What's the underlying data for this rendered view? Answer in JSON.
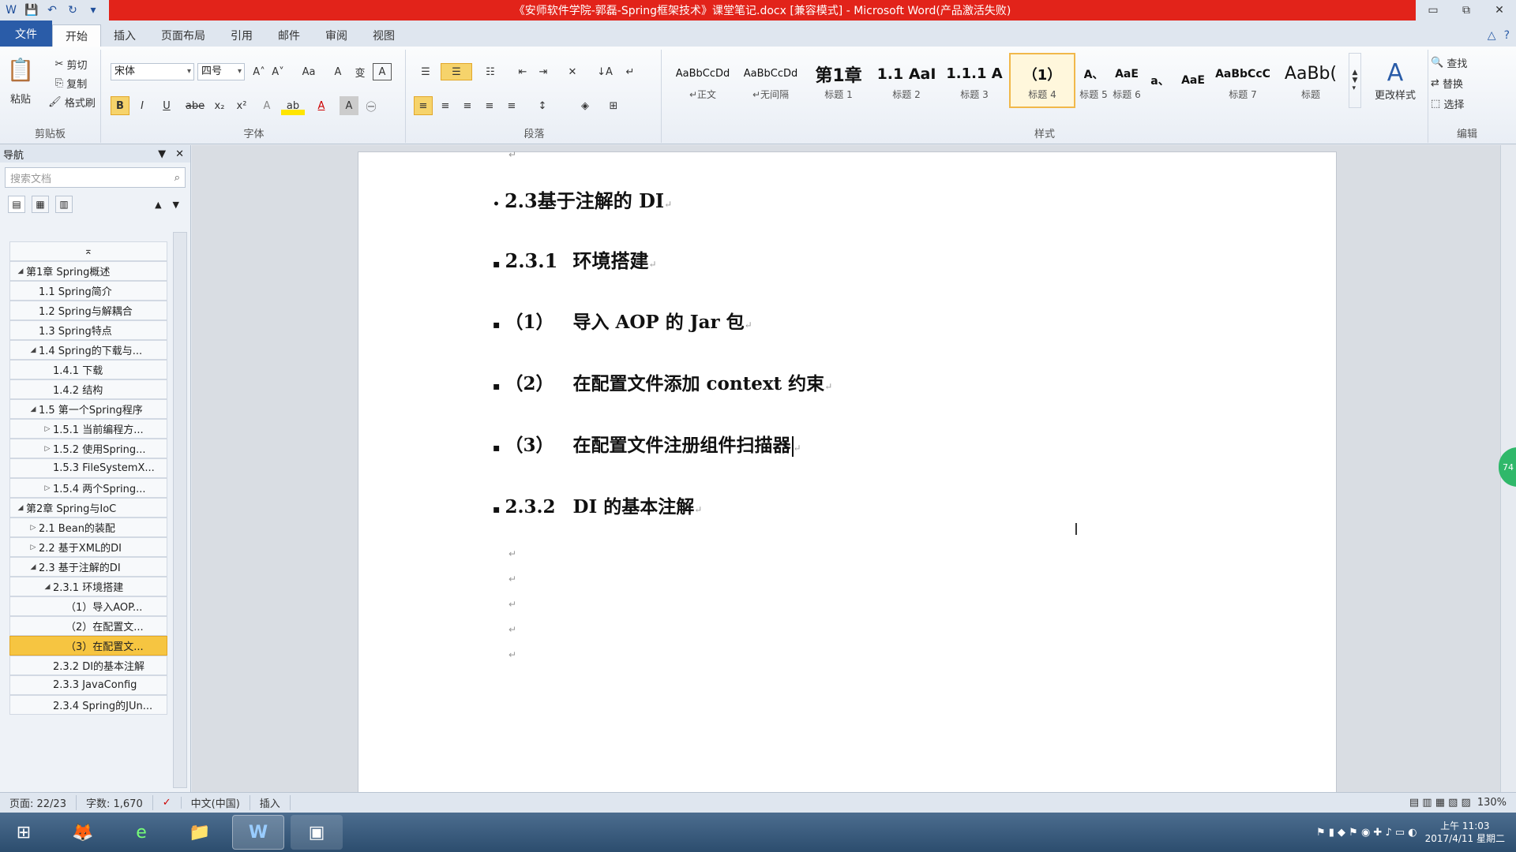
{
  "window": {
    "title": "《安师软件学院-郭磊-Spring框架技术》课堂笔记.docx [兼容模式] - Microsoft Word(产品激活失败)",
    "minimize_glyph": "▭",
    "restore_glyph": "⧉",
    "close_glyph": "✕"
  },
  "qat": {
    "word_glyph": "W",
    "save_glyph": "💾",
    "undo_glyph": "↶",
    "redo_glyph": "↻",
    "more_glyph": "▾"
  },
  "tabs": [
    {
      "label": "文件"
    },
    {
      "label": "开始"
    },
    {
      "label": "插入"
    },
    {
      "label": "页面布局"
    },
    {
      "label": "引用"
    },
    {
      "label": "邮件"
    },
    {
      "label": "审阅"
    },
    {
      "label": "视图"
    }
  ],
  "tab_right": {
    "collapse_glyph": "△",
    "help_glyph": "?"
  },
  "ribbon": {
    "clipboard": {
      "paste": "粘贴",
      "cut": "剪切",
      "copy": "复制",
      "format_painter": "格式刷",
      "label": "剪贴板"
    },
    "font": {
      "font_name": "宋体",
      "font_size": "四号",
      "grow": "A˄",
      "shrink": "A˅",
      "case": "Aa",
      "clear": "A",
      "pinyin": "变",
      "border_char": "A",
      "bold": "B",
      "italic": "I",
      "underline": "U",
      "strike": "abe",
      "sub": "x₂",
      "sup": "x²",
      "effects": "A",
      "highlight": "ab",
      "font_color": "A",
      "shade": "A",
      "enclose": "㊀",
      "label": "字体"
    },
    "paragraph": {
      "bullets": "☰",
      "numbering": "☰",
      "multilevel": "☷",
      "dec_indent": "⇤",
      "inc_indent": "⇥",
      "cjk_layout": "✕",
      "sort": "↓A",
      "show_marks": "↵",
      "align_left": "≡",
      "center": "≡",
      "align_right": "≡",
      "justify": "≡",
      "distribute": "≡",
      "line_spacing": "↕",
      "shading": "◈",
      "borders": "⊞",
      "label": "段落"
    },
    "styles": {
      "items": [
        {
          "preview": "AaBbCcDd",
          "name": "↵正文"
        },
        {
          "preview": "AaBbCcDd",
          "name": "↵无间隔"
        },
        {
          "preview": "第1章",
          "name": "标题 1"
        },
        {
          "preview": "1.1 AaI",
          "name": "标题 2"
        },
        {
          "preview": "1.1.1 A",
          "name": "标题 3"
        },
        {
          "preview": "（1）",
          "name": "标题 4"
        },
        {
          "preview": "A、",
          "name": "标题 5"
        },
        {
          "preview": "AaE",
          "name": "标题 6"
        },
        {
          "preview": "a、",
          "name": ""
        },
        {
          "preview": "AaE",
          "name": ""
        },
        {
          "preview": "AaBbCcC",
          "name": "标题 7"
        },
        {
          "preview": "AaBb(",
          "name": "标题"
        }
      ],
      "change_styles": "更改样式",
      "label": "样式"
    },
    "editing": {
      "find": "查找",
      "replace": "替换",
      "select": "选择",
      "label": "编辑"
    }
  },
  "nav": {
    "title": "导航",
    "dropdown_glyph": "▼",
    "close_glyph": "✕",
    "search_placeholder": "搜索文档",
    "search_glyph": "⌕",
    "up_glyph": "▲",
    "down_glyph": "▼",
    "items": [
      {
        "label": "",
        "toggle": "",
        "indent": 0,
        "selected": false,
        "placeholder": "⌅"
      },
      {
        "label": "第1章 Spring概述",
        "toggle": "◢",
        "indent": 0,
        "selected": false
      },
      {
        "label": "1.1 Spring简介",
        "toggle": "",
        "indent": 1,
        "selected": false
      },
      {
        "label": "1.2 Spring与解耦合",
        "toggle": "",
        "indent": 1,
        "selected": false
      },
      {
        "label": "1.3 Spring特点",
        "toggle": "",
        "indent": 1,
        "selected": false
      },
      {
        "label": "1.4 Spring的下载与...",
        "toggle": "◢",
        "indent": 1,
        "selected": false
      },
      {
        "label": "1.4.1 下载",
        "toggle": "",
        "indent": 2,
        "selected": false
      },
      {
        "label": "1.4.2 结构",
        "toggle": "",
        "indent": 2,
        "selected": false
      },
      {
        "label": "1.5 第一个Spring程序",
        "toggle": "◢",
        "indent": 1,
        "selected": false
      },
      {
        "label": "1.5.1 当前编程方...",
        "toggle": "▷",
        "indent": 2,
        "selected": false
      },
      {
        "label": "1.5.2 使用Spring...",
        "toggle": "▷",
        "indent": 2,
        "selected": false
      },
      {
        "label": "1.5.3 FileSystemX...",
        "toggle": "",
        "indent": 2,
        "selected": false
      },
      {
        "label": "1.5.4 两个Spring...",
        "toggle": "▷",
        "indent": 2,
        "selected": false
      },
      {
        "label": "第2章 Spring与IoC",
        "toggle": "◢",
        "indent": 0,
        "selected": false
      },
      {
        "label": "2.1 Bean的装配",
        "toggle": "▷",
        "indent": 1,
        "selected": false
      },
      {
        "label": "2.2 基于XML的DI",
        "toggle": "▷",
        "indent": 1,
        "selected": false
      },
      {
        "label": "2.3 基于注解的DI",
        "toggle": "◢",
        "indent": 1,
        "selected": false
      },
      {
        "label": "2.3.1 环境搭建",
        "toggle": "◢",
        "indent": 2,
        "selected": false
      },
      {
        "label": "（1）导入AOP...",
        "toggle": "",
        "indent": 3,
        "selected": false
      },
      {
        "label": "（2）在配置文...",
        "toggle": "",
        "indent": 3,
        "selected": false
      },
      {
        "label": "（3）在配置文...",
        "toggle": "",
        "indent": 3,
        "selected": true
      },
      {
        "label": "2.3.2 DI的基本注解",
        "toggle": "",
        "indent": 2,
        "selected": false
      },
      {
        "label": "2.3.3 JavaConfig",
        "toggle": "",
        "indent": 2,
        "selected": false
      },
      {
        "label": "2.3.4 Spring的JUn...",
        "toggle": "",
        "indent": 2,
        "selected": false
      }
    ]
  },
  "document": {
    "headings": [
      {
        "bullet": "•",
        "num": "2.3",
        "text": "基于注解的 DI",
        "mark": "↵"
      },
      {
        "bullet": "▪",
        "num": "2.3.1",
        "text": "环境搭建",
        "mark": "↵"
      },
      {
        "bullet": "▪",
        "num": "（1）",
        "text": "导入 AOP 的 Jar 包",
        "mark": "↵"
      },
      {
        "bullet": "▪",
        "num": "（2）",
        "text": "在配置文件添加 context 约束",
        "mark": "↵"
      },
      {
        "bullet": "▪",
        "num": "（3）",
        "text": "在配置文件注册组件扫描器",
        "mark": "↵"
      },
      {
        "bullet": "▪",
        "num": "2.3.2",
        "text": "DI 的基本注解",
        "mark": "↵"
      }
    ],
    "top_mark": "↵",
    "empty_marks": [
      "↵",
      "↵",
      "↵",
      "↵",
      "↵"
    ],
    "ibeam_glyph": "I"
  },
  "scroll_badge": "74",
  "status": {
    "page": "页面: 22/23",
    "words": "字数: 1,670",
    "proof_glyph": "✓",
    "language": "中文(中国)",
    "mode": "插入",
    "zoom": "130%",
    "view_glyphs": "▤ ▥ ▦ ▧ ▨"
  },
  "taskbar": {
    "start_glyph": "⊞",
    "apps": [
      {
        "glyph": "🦊"
      },
      {
        "glyph": "e"
      },
      {
        "glyph": "📁"
      },
      {
        "glyph": "W"
      },
      {
        "glyph": "▣"
      }
    ],
    "tray_glyphs": "⚑ ▮ ◆ ⚑ ◉ ✚ ♪ ▭ ◐",
    "time": "上午 11:03",
    "date": "2017/4/11 星期二"
  }
}
